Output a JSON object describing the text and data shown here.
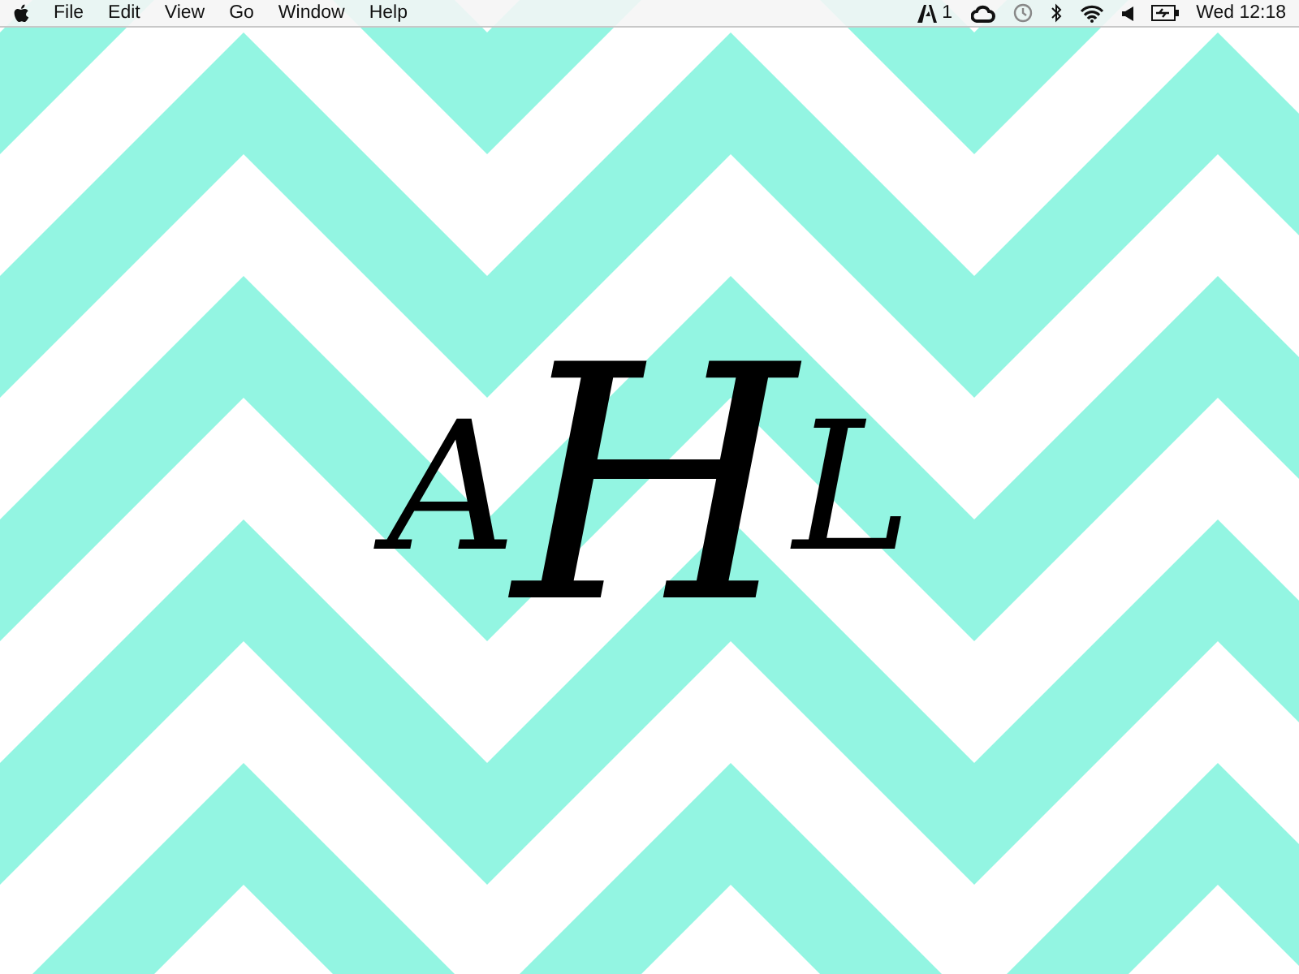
{
  "menu_bar": {
    "menus": [
      "File",
      "Edit",
      "View",
      "Go",
      "Window",
      "Help"
    ],
    "status": {
      "adobe_count": "1",
      "clock": "Wed 12:18"
    }
  },
  "wallpaper": {
    "monogram": {
      "left": "A",
      "center": "H",
      "right": "L"
    }
  }
}
